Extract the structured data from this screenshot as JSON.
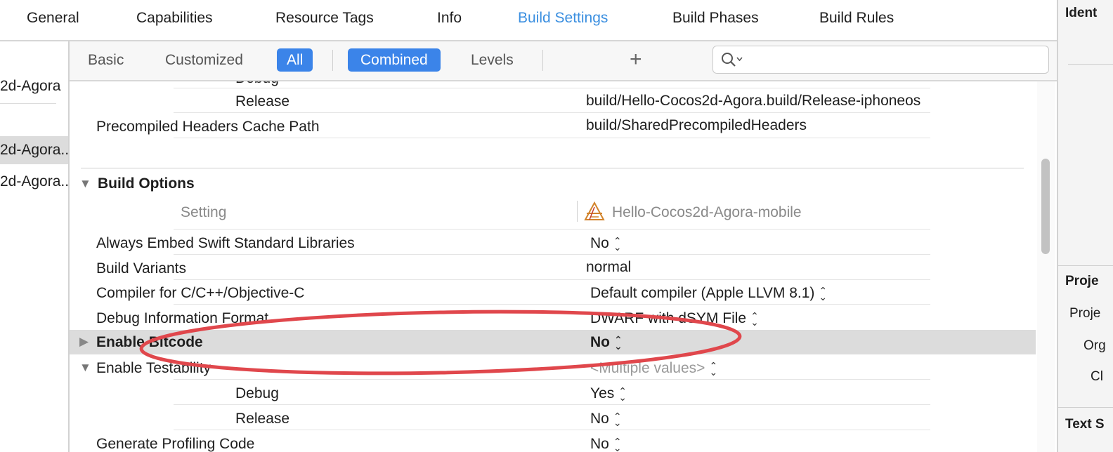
{
  "tabs": [
    {
      "label": "General",
      "active": false
    },
    {
      "label": "Capabilities",
      "active": false
    },
    {
      "label": "Resource Tags",
      "active": false
    },
    {
      "label": "Info",
      "active": false
    },
    {
      "label": "Build Settings",
      "active": true
    },
    {
      "label": "Build Phases",
      "active": false
    },
    {
      "label": "Build Rules",
      "active": false
    }
  ],
  "inspector": {
    "identity_heading": "Ident",
    "project_heading": "Proje",
    "project_label": "Proje",
    "org_label": "Org",
    "class_label": "Cl",
    "text_heading": "Text S"
  },
  "sidebar": {
    "items": [
      {
        "label": "2d-Agora"
      },
      {
        "label": "2d-Agora..."
      },
      {
        "label": "2d-Agora..."
      }
    ]
  },
  "filter": {
    "basic": "Basic",
    "customized": "Customized",
    "all": "All",
    "combined": "Combined",
    "levels": "Levels",
    "add": "+",
    "search_placeholder": ""
  },
  "settings": {
    "debug_partial_label": "Debug",
    "release_label": "Release",
    "release_value": "build/Hello-Cocos2d-Agora.build/Release-iphoneos",
    "pch_label": "Precompiled Headers Cache Path",
    "pch_value": "build/SharedPrecompiledHeaders",
    "section_title": "Build Options",
    "col_setting": "Setting",
    "col_target": "Hello-Cocos2d-Agora-mobile",
    "rows": [
      {
        "name": "Always Embed Swift Standard Libraries",
        "value": "No"
      },
      {
        "name": "Build Variants",
        "value": "normal"
      },
      {
        "name": "Compiler for C/C++/Objective-C",
        "value": "Default compiler (Apple LLVM 8.1)"
      },
      {
        "name": "Debug Information Format",
        "value": "DWARF with dSYM File"
      },
      {
        "name": "Enable Bitcode",
        "value": "No"
      },
      {
        "name": "Enable Testability",
        "value": "<Multiple values>"
      },
      {
        "name": "Debug",
        "value": "Yes"
      },
      {
        "name": "Release",
        "value": "No"
      },
      {
        "name": "Generate Profiling Code",
        "value": "No"
      }
    ]
  },
  "colors": {
    "accent": "#3b8fe0",
    "selected_button": "#3b84e9",
    "highlight_row": "#dcdcdc",
    "annotation": "#e0474c"
  }
}
